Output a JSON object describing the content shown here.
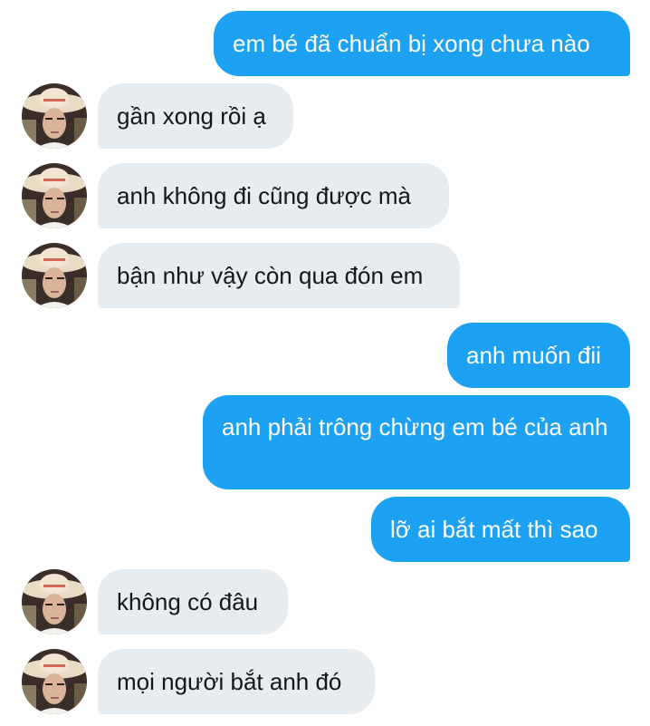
{
  "conversation": {
    "messages": [
      {
        "direction": "outgoing",
        "text": "em bé đã chuẩn bị xong chưa nào"
      },
      {
        "direction": "incoming",
        "text": "gần xong rồi ạ"
      },
      {
        "direction": "incoming",
        "text": "anh không đi cũng được mà"
      },
      {
        "direction": "incoming",
        "text": "bận như vậy còn qua đón em"
      },
      {
        "direction": "outgoing",
        "text": "anh muốn đii"
      },
      {
        "direction": "outgoing",
        "text": "anh phải trông chừng em bé của anh"
      },
      {
        "direction": "outgoing",
        "text": "lỡ ai bắt mất thì sao"
      },
      {
        "direction": "incoming",
        "text": "không có đâu"
      },
      {
        "direction": "incoming",
        "text": "mọi người bắt anh đó"
      }
    ]
  },
  "colors": {
    "outgoing_bubble": "#1da1f2",
    "incoming_bubble": "#e6ecf0",
    "outgoing_text": "#ffffff",
    "incoming_text": "#14171a"
  },
  "avatar_icon": "user-avatar-photo"
}
